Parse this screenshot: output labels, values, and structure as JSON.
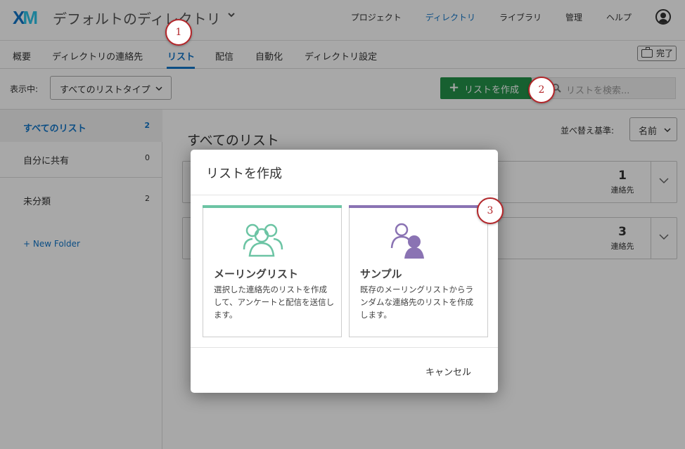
{
  "header": {
    "logo_x": "X",
    "logo_m": "M",
    "directory_title": "デフォルトのディレクトリ",
    "nav": [
      "プロジェクト",
      "ディレクトリ",
      "ライブラリ",
      "管理",
      "ヘルプ"
    ]
  },
  "tabs": [
    "概要",
    "ディレクトリの連絡先",
    "リスト",
    "配信",
    "自動化",
    "ディレクトリ設定"
  ],
  "done_label": "完了",
  "filter": {
    "showing_label": "表示中:",
    "type_value": "すべてのリストタイプ",
    "create_label": "リストを作成",
    "search_placeholder": "リストを検索..."
  },
  "sidebar": {
    "items": [
      {
        "label": "すべてのリスト",
        "count": "2"
      },
      {
        "label": "自分に共有",
        "count": "0"
      },
      {
        "label": "未分類",
        "count": "2"
      }
    ],
    "new_folder": "+ New Folder"
  },
  "main": {
    "title": "すべてのリスト",
    "sort_label": "並べ替え基準:",
    "sort_value": "名前",
    "lists": [
      {
        "count": "1",
        "unit": "連絡先"
      },
      {
        "count": "3",
        "unit": "連絡先"
      }
    ]
  },
  "modal": {
    "title": "リストを作成",
    "options": [
      {
        "title": "メーリングリスト",
        "desc": "選択した連絡先のリストを作成して、アンケートと配信を送信します。",
        "accent": "#6cc4a4"
      },
      {
        "title": "サンプル",
        "desc": "既存のメーリングリストからランダムな連絡先のリストを作成します。",
        "accent": "#8a73b3"
      }
    ],
    "cancel_label": "キャンセル"
  },
  "markers": [
    "1",
    "2",
    "3"
  ],
  "colors": {
    "brand_blue": "#1176c8",
    "create_green": "#24924a",
    "marker_red": "#b3262a"
  }
}
